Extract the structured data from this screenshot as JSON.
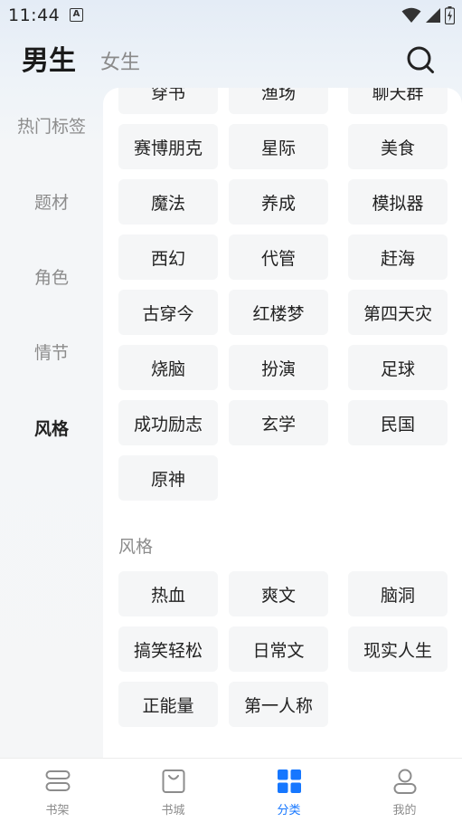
{
  "status_bar": {
    "time": "11:44",
    "notif_letter": "A"
  },
  "header": {
    "tab_male": "男生",
    "tab_female": "女生"
  },
  "side_nav": [
    "热门标签",
    "题材",
    "角色",
    "情节",
    "风格"
  ],
  "partial_row": [
    "穿书",
    "渔场",
    "聊天群"
  ],
  "plot_tags": [
    "赛博朋克",
    "星际",
    "美食",
    "魔法",
    "养成",
    "模拟器",
    "西幻",
    "代管",
    "赶海",
    "古穿今",
    "红楼梦",
    "第四天灾",
    "烧脑",
    "扮演",
    "足球",
    "成功励志",
    "玄学",
    "民国",
    "原神"
  ],
  "style_section": {
    "title": "风格",
    "tags": [
      "热血",
      "爽文",
      "脑洞",
      "搞笑轻松",
      "日常文",
      "现实人生",
      "正能量",
      "第一人称"
    ]
  },
  "bottom_nav": [
    "书架",
    "书城",
    "分类",
    "我的"
  ],
  "colors": {
    "accent": "#1677ff",
    "tag_bg": "#f5f6f7"
  }
}
